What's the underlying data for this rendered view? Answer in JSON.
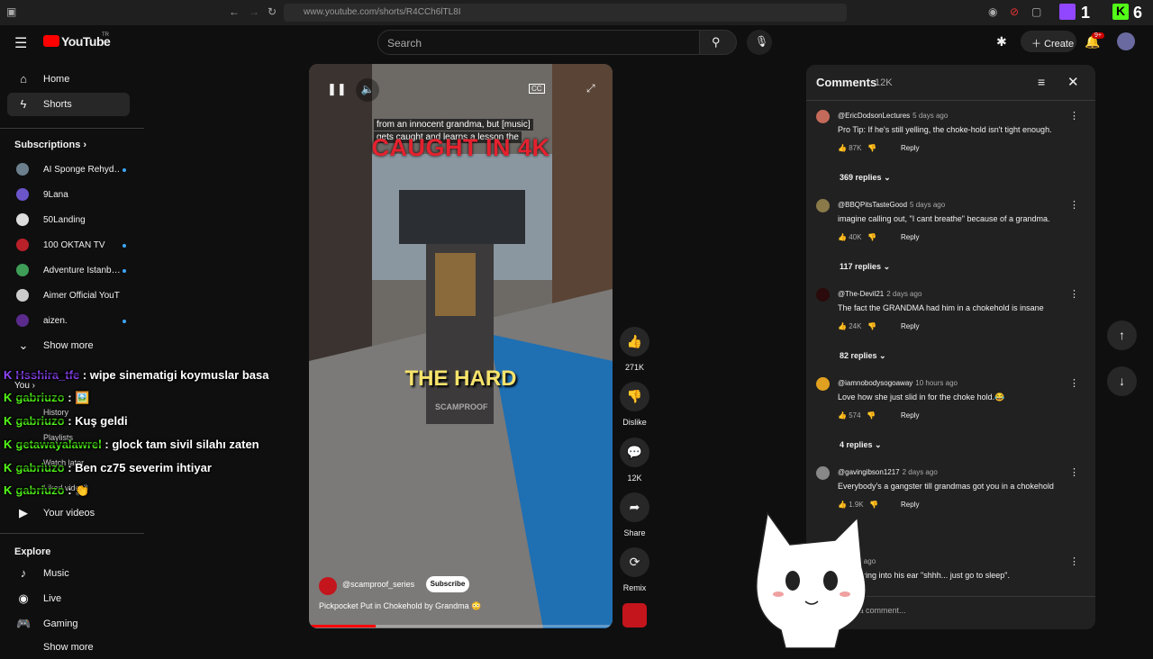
{
  "browser": {
    "url": "www.youtube.com/shorts/R4CCh6lTL8I",
    "twitch_count_1": "1",
    "twitch_count_2": "6"
  },
  "header": {
    "logo_text": "YouTube",
    "logo_sup": "TR",
    "search_placeholder": "Search",
    "create_label": "Create",
    "notif_badge": "9+"
  },
  "sidebar": {
    "main": [
      {
        "label": "Home",
        "icon": "home-icon"
      },
      {
        "label": "Shorts",
        "icon": "shorts-icon"
      }
    ],
    "subscriptions_title": "Subscriptions",
    "subscriptions": [
      {
        "label": "AI Sponge Rehyd…",
        "color": "#6b7f8d",
        "live": true
      },
      {
        "label": "9Lana",
        "color": "#6b55c9",
        "live": false
      },
      {
        "label": "50Landing",
        "color": "#dddddd",
        "live": false
      },
      {
        "label": "100 OKTAN TV",
        "color": "#b8202a",
        "live": true
      },
      {
        "label": "Adventure Istanb…",
        "color": "#3e9d56",
        "live": true
      },
      {
        "label": "Aimer Official YouT…",
        "color": "#cccccc",
        "live": false
      },
      {
        "label": "aizen.",
        "color": "#5a2b8c",
        "live": true
      }
    ],
    "show_more": "Show more",
    "you_title": "You",
    "you_items": [
      "History",
      "Playlists",
      "Watch later",
      "Liked videos",
      "Your videos"
    ],
    "explore_title": "Explore",
    "explore": [
      "Music",
      "Live",
      "Gaming",
      "Show more"
    ]
  },
  "chat": [
    {
      "user": "Hsshira_tfe",
      "msg": ": wipe sinematigi koymuslar basa",
      "color": "#9146ff"
    },
    {
      "user": "gabriuzo",
      "msg": ": 🖼️",
      "color": "#53fc18"
    },
    {
      "user": "gabriuzo",
      "msg": ": Kuş geldi",
      "color": "#53fc18"
    },
    {
      "user": "getawayalawrel",
      "msg": ": glock tam sivil silahı zaten",
      "color": "#53fc18"
    },
    {
      "user": "gabriuzo",
      "msg": ": Ben cz75 severim ihtiyar",
      "color": "#53fc18"
    },
    {
      "user": "gabriuzo",
      "msg": ": 👏",
      "color": "#53fc18"
    }
  ],
  "video": {
    "caption_line1": "from an innocent grandma, but [music]",
    "caption_line2": "gets caught and learns a lesson the",
    "overlay_top": "CAUGHT IN 4K",
    "overlay_mid": "THE HARD",
    "watermark": "SCAMPROOF",
    "channel": "@scamproof_series",
    "subscribe": "Subscribe",
    "title": "Pickpocket Put in Chokehold by Grandma 😳",
    "progress": 0.22
  },
  "actions": [
    {
      "name": "like",
      "label": "271K",
      "glyph": "👍"
    },
    {
      "name": "dislike",
      "label": "Dislike",
      "glyph": "👎"
    },
    {
      "name": "comments",
      "label": "12K",
      "glyph": "💬"
    },
    {
      "name": "share",
      "label": "Share",
      "glyph": "➦"
    },
    {
      "name": "remix",
      "label": "Remix",
      "glyph": "⟳"
    }
  ],
  "comments": {
    "title": "Comments",
    "count": "12K",
    "input_placeholder": "Add a comment...",
    "items": [
      {
        "author": "@EricDodsonLectures",
        "time": "5 days ago",
        "text": "Pro Tip:  If he's still yelling, the choke-hold isn't tight enough.",
        "likes": "87K",
        "reply": "Reply",
        "replies": "369 replies",
        "color": "#c46a5a"
      },
      {
        "author": "@BBQPitsTasteGood",
        "time": "5 days ago",
        "text": "imagine calling out, \"I cant breathe\" because of a grandma.",
        "likes": "40K",
        "reply": "Reply",
        "replies": "117 replies",
        "color": "#8a7a4a"
      },
      {
        "author": "@The-Devil21",
        "time": "2 days ago",
        "text": "The fact the GRANDMA had him in a chokehold is insane",
        "likes": "24K",
        "reply": "Reply",
        "replies": "82 replies",
        "color": "#2a0a0a"
      },
      {
        "author": "@iamnobodysogoaway",
        "time": "10 hours ago",
        "text": "Love how she just slid in for the choke hold.😂",
        "likes": "574",
        "reply": "Reply",
        "replies": "4 replies",
        "color": "#e0a020"
      },
      {
        "author": "@gavingibson1217",
        "time": "2 days ago",
        "text": "Everybody's a gangster till grandmas got you in a chokehold",
        "likes": "1.9K",
        "reply": "Reply",
        "replies": "",
        "color": "#888888"
      },
      {
        "author": "",
        "time": "2 days ago",
        "text": "whispering into his ear \"shhh... just go to sleep\".",
        "likes": "",
        "reply": "",
        "replies": "",
        "color": "#444444"
      }
    ]
  }
}
